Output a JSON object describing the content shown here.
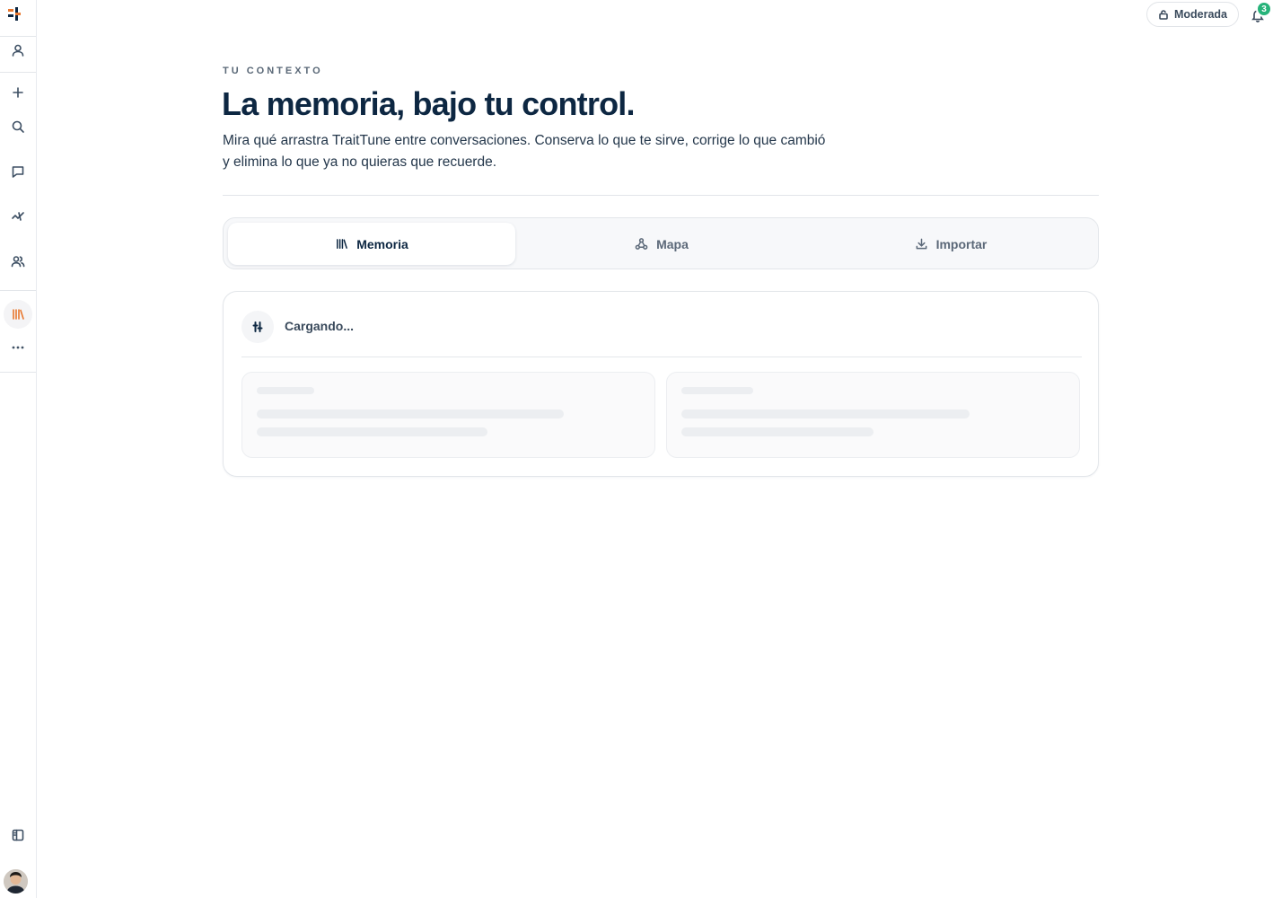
{
  "sidebar": {
    "items": [
      {
        "name": "profile-icon"
      },
      {
        "name": "new-icon"
      },
      {
        "name": "search-icon"
      },
      {
        "name": "chat-icon"
      },
      {
        "name": "activity-icon"
      },
      {
        "name": "people-icon"
      },
      {
        "name": "library-icon",
        "active": true
      },
      {
        "name": "more-icon"
      }
    ],
    "bottom": [
      {
        "name": "panel-toggle-icon"
      }
    ]
  },
  "header": {
    "mode_label": "Moderada",
    "notification_count": "3"
  },
  "main": {
    "eyebrow": "TU CONTEXTO",
    "title": "La memoria, bajo tu control.",
    "subtitle": "Mira qué arrastra TraitTune entre conversaciones. Conserva lo que te sirve, corrige lo que cambió y elimina lo que ya no quieras que recuerde.",
    "tabs": [
      {
        "label": "Memoria",
        "icon": "library-icon",
        "active": true
      },
      {
        "label": "Mapa",
        "icon": "map-icon",
        "active": false
      },
      {
        "label": "Importar",
        "icon": "download-icon",
        "active": false
      }
    ],
    "card": {
      "status": "Cargando..."
    }
  },
  "colors": {
    "accent": "#e8772e",
    "primary_text": "#0d2742",
    "badge": "#27b37a"
  }
}
